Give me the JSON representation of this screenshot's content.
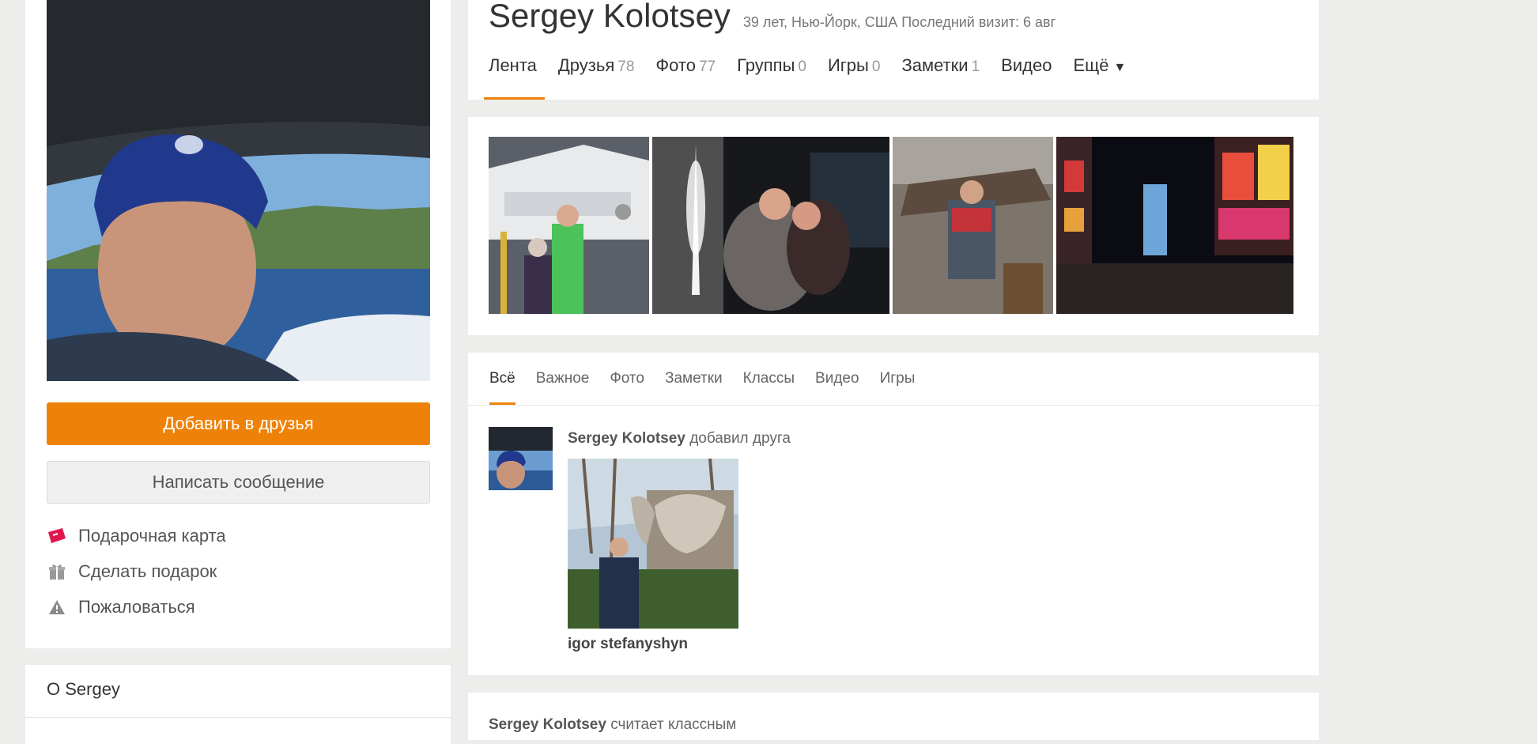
{
  "profile": {
    "name": "Sergey Kolotsey",
    "meta": "39 лет, Нью-Йорк, США  Последний визит: 6 авг"
  },
  "nav": {
    "tabs": [
      {
        "label": "Лента",
        "count": ""
      },
      {
        "label": "Друзья",
        "count": "78"
      },
      {
        "label": "Фото",
        "count": "77"
      },
      {
        "label": "Группы",
        "count": "0"
      },
      {
        "label": "Игры",
        "count": "0"
      },
      {
        "label": "Заметки",
        "count": "1"
      },
      {
        "label": "Видео",
        "count": ""
      },
      {
        "label": "Ещё",
        "count": ""
      }
    ],
    "more_arrow": "▼"
  },
  "sidebar": {
    "add_friend": "Добавить в друзья",
    "send_message": "Написать сообщение",
    "links": {
      "gift_card": "Подарочная карта",
      "make_gift": "Сделать подарок",
      "report": "Пожаловаться"
    },
    "about_title": "О Sergey"
  },
  "feed": {
    "tabs": [
      "Всё",
      "Важное",
      "Фото",
      "Заметки",
      "Классы",
      "Видео",
      "Игры"
    ],
    "event1": {
      "author": "Sergey Kolotsey",
      "action": "добавил друга",
      "friend_name": "igor stefanyshyn"
    },
    "event2": {
      "author": "Sergey Kolotsey",
      "action": "считает классным"
    }
  },
  "colors": {
    "accent": "#ee8208",
    "background": "#ededec"
  },
  "icons": {
    "gift_card": "gift-card-icon",
    "make_gift": "gift-box-icon",
    "report": "warning-icon"
  }
}
